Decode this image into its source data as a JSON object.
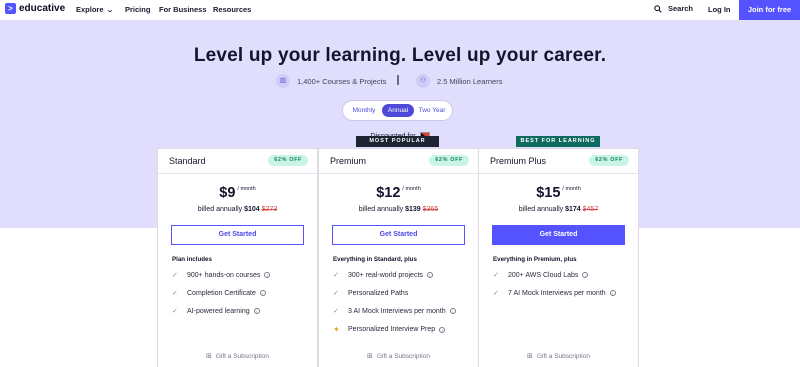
{
  "nav": {
    "logo": "educative",
    "explore": "Explore",
    "pricing": "Pricing",
    "for_business": "For Business",
    "resources": "Resources",
    "search": "Search",
    "login": "Log In",
    "join": "Join for free"
  },
  "hero": {
    "headline": "Level up your learning. Level up your career.",
    "courses": "1,400+ Courses & Projects",
    "learners": "2.5 Million Learners"
  },
  "billing": {
    "options": [
      "Monthly",
      "Annual",
      "Two Year"
    ],
    "selected": "Annual"
  },
  "discount": "Discounted for",
  "plans": [
    {
      "name": "Standard",
      "off": "62% OFF",
      "price": "$9",
      "per": "/ month",
      "billed_prefix": "billed annually",
      "billed_price": "$104",
      "billed_old": "$273",
      "cta": "Get Started",
      "features_title": "Plan includes",
      "features": [
        "900+ hands-on courses",
        "Completion Certificate",
        "AI-powered learning"
      ],
      "gift": "Gift a Subscription"
    },
    {
      "name": "Premium",
      "ribbon": "MOST POPULAR",
      "off": "62% OFF",
      "price": "$12",
      "per": "/ month",
      "billed_prefix": "billed annually",
      "billed_price": "$139",
      "billed_old": "$365",
      "cta": "Get Started",
      "features_title": "Everything in Standard, plus",
      "features": [
        "300+ real-world projects",
        "Personalized Paths",
        "3 AI Mock Interviews per month",
        "Personalized Interview Prep"
      ],
      "gift": "Gift a Subscription"
    },
    {
      "name": "Premium Plus",
      "ribbon": "BEST FOR LEARNING",
      "off": "62% OFF",
      "price": "$15",
      "per": "/ month",
      "billed_prefix": "billed annually",
      "billed_price": "$174",
      "billed_old": "$457",
      "cta": "Get Started",
      "features_title": "Everything in Premium, plus",
      "features": [
        "200+ AWS Cloud Labs",
        "7 AI Mock Interviews per month"
      ],
      "gift": "Gift a Subscription"
    }
  ],
  "colors": {
    "brand": "#5553ff",
    "hero_bg": "#e0defc",
    "off_badge_bg": "#c9f5e4",
    "ribbon_popular": "#1f2433",
    "ribbon_best": "#0f6b5d"
  }
}
